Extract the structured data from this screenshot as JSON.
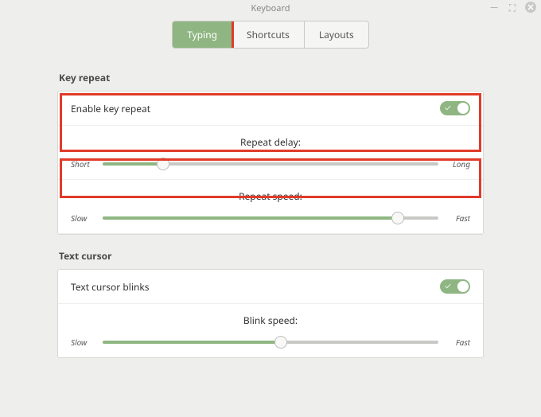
{
  "window": {
    "title": "Keyboard"
  },
  "tabs": [
    {
      "label": "Typing",
      "active": true
    },
    {
      "label": "Shortcuts",
      "active": false
    },
    {
      "label": "Layouts",
      "active": false
    }
  ],
  "sections": {
    "keyRepeat": {
      "title": "Key repeat",
      "enable": {
        "label": "Enable key repeat",
        "value": true
      },
      "delay": {
        "label": "Repeat delay:",
        "min_label": "Short",
        "max_label": "Long",
        "value_pct": 18
      },
      "speed": {
        "label": "Repeat speed:",
        "min_label": "Slow",
        "max_label": "Fast",
        "value_pct": 88
      }
    },
    "textCursor": {
      "title": "Text cursor",
      "blinks": {
        "label": "Text cursor blinks",
        "value": true
      },
      "blinkSpeed": {
        "label": "Blink speed:",
        "min_label": "Slow",
        "max_label": "Fast",
        "value_pct": 53
      }
    }
  }
}
